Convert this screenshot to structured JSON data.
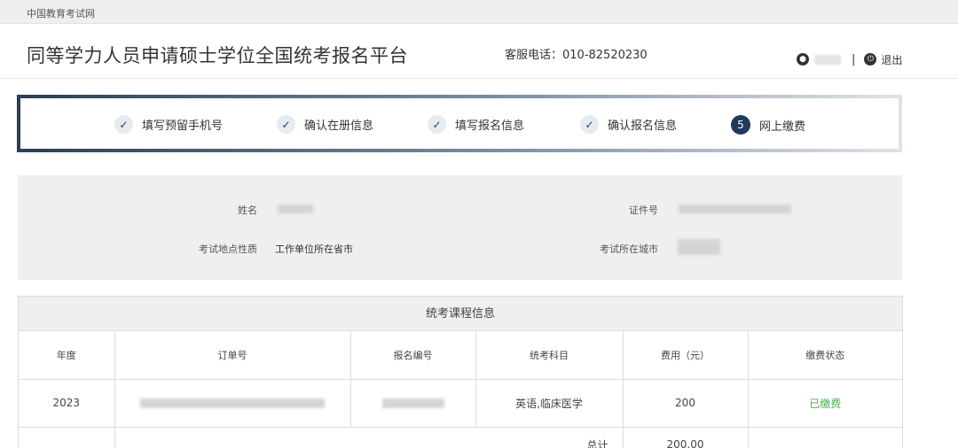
{
  "topbar": {
    "site": "中国教育考试网"
  },
  "header": {
    "title": "同等学力人员申请硕士学位全国统考报名平台",
    "hotline": "客服电话：010-82520230",
    "separator": "|",
    "logout": "退出"
  },
  "steps": [
    {
      "label": "填写预留手机号",
      "marker": "✓",
      "state": "done"
    },
    {
      "label": "确认在册信息",
      "marker": "✓",
      "state": "done"
    },
    {
      "label": "填写报名信息",
      "marker": "✓",
      "state": "done"
    },
    {
      "label": "确认报名信息",
      "marker": "✓",
      "state": "done"
    },
    {
      "label": "网上缴费",
      "marker": "5",
      "state": "current"
    }
  ],
  "info": {
    "name_label": "姓名",
    "id_label": "证件号",
    "site_type_label": "考试地点性质",
    "site_type_value": "工作单位所在省市",
    "city_label": "考试所在城市"
  },
  "course": {
    "title": "统考课程信息",
    "headers": [
      "年度",
      "订单号",
      "报名编号",
      "统考科目",
      "费用（元）",
      "缴费状态"
    ],
    "rows": [
      {
        "year": "2023",
        "subject": "英语,临床医学",
        "fee": "200",
        "status": "已缴费"
      }
    ],
    "total_label": "总计",
    "total_value": "200.00"
  },
  "colors": {
    "accent": "#1f3a5c",
    "paid": "#4caf50",
    "panel": "#efefef"
  }
}
